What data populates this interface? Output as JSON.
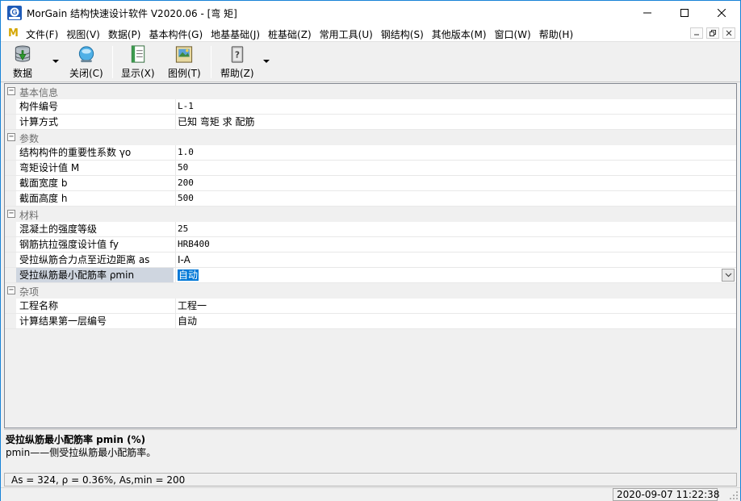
{
  "window": {
    "title": "MorGain 结构快速设计软件 V2020.06 - [弯 矩]"
  },
  "menu": {
    "logo": "M",
    "items": [
      "文件(F)",
      "视图(V)",
      "数据(P)",
      "基本构件(G)",
      "地基基础(J)",
      "桩基础(Z)",
      "常用工具(U)",
      "钢结构(S)",
      "其他版本(M)",
      "窗口(W)",
      "帮助(H)"
    ]
  },
  "toolbar": {
    "data_label": "数据",
    "close_label": "关闭(C)",
    "display_label": "显示(X)",
    "legend_label": "图例(T)",
    "help_label": "帮助(Z)"
  },
  "grid": {
    "categories": [
      {
        "label": "基本信息",
        "toggle": "−",
        "props": [
          {
            "name": "构件编号",
            "value": "L-1"
          },
          {
            "name": "计算方式",
            "value": "已知 弯矩 求 配筋"
          }
        ]
      },
      {
        "label": "参数",
        "toggle": "−",
        "props": [
          {
            "name": "结构构件的重要性系数 γo",
            "value": "1.0"
          },
          {
            "name": "弯矩设计值 M",
            "value": "50"
          },
          {
            "name": "截面宽度 b",
            "value": "200"
          },
          {
            "name": "截面高度 h",
            "value": "500"
          }
        ]
      },
      {
        "label": "材料",
        "toggle": "−",
        "props": [
          {
            "name": "混凝土的强度等级",
            "value": "25"
          },
          {
            "name": "钢筋抗拉强度设计值 fy",
            "value": "HRB400"
          },
          {
            "name": "受拉纵筋合力点至近边距离 as",
            "value": " Ⅰ-A"
          },
          {
            "name": "受拉纵筋最小配筋率 ρmin",
            "value": "自动"
          }
        ]
      },
      {
        "label": "杂项",
        "toggle": "−",
        "props": [
          {
            "name": "工程名称",
            "value": "工程一"
          },
          {
            "name": "计算结果第一层编号",
            "value": "自动"
          }
        ]
      }
    ]
  },
  "description": {
    "title": "受拉纵筋最小配筋率  pmin (%)",
    "body": "pmin——侧受拉纵筋最小配筋率。"
  },
  "result": {
    "text": "As = 324, ρ = 0.36%, As,min = 200"
  },
  "status": {
    "datetime": "2020-09-07 11:22:38"
  },
  "colors": {
    "accent": "#0078d7",
    "window_border": "#1883d7",
    "selected_name_bg": "#cfd6e0"
  }
}
